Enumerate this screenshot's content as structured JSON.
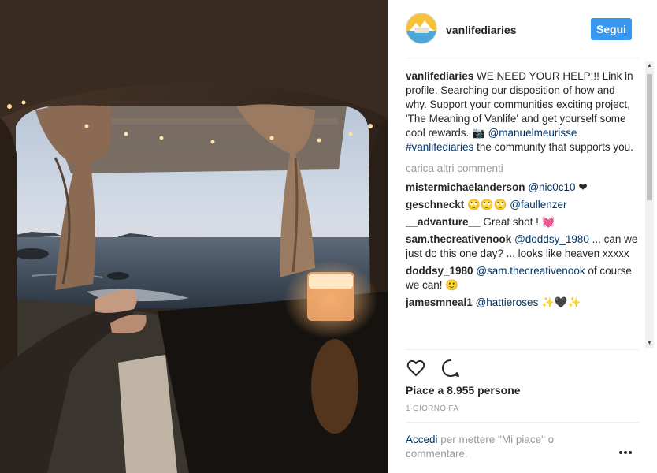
{
  "post": {
    "username": "vanlifediaries",
    "follow_label": "Segui",
    "caption": {
      "username": "vanlifediaries",
      "text_1": " WE NEED YOUR HELP!!! Link in profile. Searching our disposition of how and why. Support your communities exciting project, 'The Meaning of Vanlife' and get yourself some cool rewards. 📷 ",
      "mention": "@manuelmeurisse",
      "text_2": " ",
      "hashtag": "#vanlifediaries",
      "text_3": " the community that supports you."
    },
    "load_more": "carica altri commenti",
    "comments": [
      {
        "user": "mistermichaelanderson",
        "mention": "@nic0c10",
        "text": " ❤"
      },
      {
        "user": "geschneckt",
        "text_before": "🙄🙄🙄 ",
        "mention": "@faullenzer",
        "text": ""
      },
      {
        "user": "__advanture__",
        "text_before": "Great shot ! 💓",
        "mention": "",
        "text": ""
      },
      {
        "user": "sam.thecreativenook",
        "mention": "@doddsy_1980",
        "text": " ... can we just do this one day? ... looks like heaven xxxxx"
      },
      {
        "user": "doddsy_1980",
        "mention": "@sam.thecreativenook",
        "text": " of course we can! 🙂"
      },
      {
        "user": "jamesmneal1",
        "mention": "@hattieroses",
        "text": " ✨🖤✨"
      }
    ],
    "likes": "Piace a 8.955 persone",
    "timestamp": "1 GIORNO FA",
    "login": {
      "link": "Accedi",
      "text": " per mettere \"Mi piace\" o commentare."
    }
  },
  "icons": {
    "like": "heart-icon",
    "comment": "comment-bubble-icon",
    "more": "more-options-icon"
  },
  "colors": {
    "follow_button": "#3897f0",
    "link": "#003569",
    "muted": "#999999",
    "text": "#262626"
  }
}
